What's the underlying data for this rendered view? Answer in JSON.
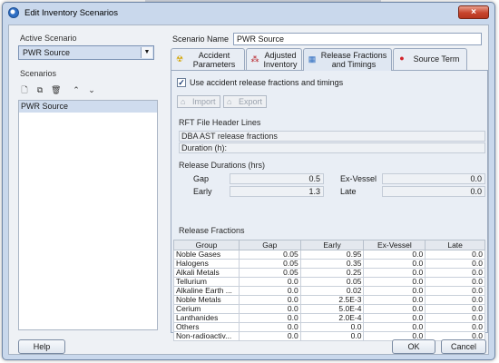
{
  "window": {
    "title": "Edit Inventory Scenarios",
    "close_glyph": "×"
  },
  "left": {
    "active_scenario_label": "Active Scenario",
    "active_scenario_value": "PWR Source",
    "scenarios_label": "Scenarios",
    "toolbar_icons": [
      "new-icon",
      "copy-icon",
      "delete-icon",
      "move-up-icon",
      "move-down-icon"
    ],
    "scenarios": [
      "PWR Source"
    ]
  },
  "right": {
    "scenario_name_label": "Scenario Name",
    "scenario_name_value": "PWR Source",
    "tabs": [
      {
        "label": "Accident\nParameters",
        "icon": "radiation-icon"
      },
      {
        "label": "Adjusted\nInventory",
        "icon": "molecule-icon"
      },
      {
        "label": "Release Fractions\nand Timings",
        "icon": "chart-icon"
      },
      {
        "label": "Source Term",
        "icon": "red-circle-icon"
      }
    ],
    "active_tab": 2,
    "use_release_label": "Use accident release fractions and timings",
    "use_release_checked": true,
    "import_label": "Import",
    "export_label": "Export",
    "rft_header_label": "RFT File Header Lines",
    "rft_header_lines": [
      "DBA AST release fractions",
      "Duration (h):"
    ],
    "release_durations_label": "Release Durations (hrs)",
    "durations": {
      "gap_label": "Gap",
      "gap_value": "0.5",
      "early_label": "Early",
      "early_value": "1.3",
      "exvessel_label": "Ex-Vessel",
      "exvessel_value": "0.0",
      "late_label": "Late",
      "late_value": "0.0"
    },
    "release_fractions_label": "Release Fractions",
    "table": {
      "columns": [
        "Group",
        "Gap",
        "Early",
        "Ex-Vessel",
        "Late"
      ],
      "rows": [
        [
          "Noble Gases",
          "0.05",
          "0.95",
          "0.0",
          "0.0"
        ],
        [
          "Halogens",
          "0.05",
          "0.35",
          "0.0",
          "0.0"
        ],
        [
          "Alkali Metals",
          "0.05",
          "0.25",
          "0.0",
          "0.0"
        ],
        [
          "Tellurium",
          "0.0",
          "0.05",
          "0.0",
          "0.0"
        ],
        [
          "Alkaline Earth ...",
          "0.0",
          "0.02",
          "0.0",
          "0.0"
        ],
        [
          "Noble Metals",
          "0.0",
          "2.5E-3",
          "0.0",
          "0.0"
        ],
        [
          "Cerium",
          "0.0",
          "5.0E-4",
          "0.0",
          "0.0"
        ],
        [
          "Lanthanides",
          "0.0",
          "2.0E-4",
          "0.0",
          "0.0"
        ],
        [
          "Others",
          "0.0",
          "0.0",
          "0.0",
          "0.0"
        ],
        [
          "Non-radioactiv...",
          "0.0",
          "0.0",
          "0.0",
          "0.0"
        ]
      ]
    }
  },
  "footer": {
    "help_label": "Help",
    "ok_label": "OK",
    "cancel_label": "Cancel"
  },
  "colors": {
    "window_frame": "#c9d8ec",
    "selection": "#cfdcee",
    "close_button": "#c7442c"
  }
}
